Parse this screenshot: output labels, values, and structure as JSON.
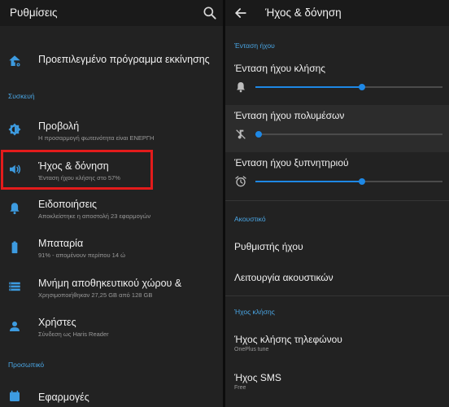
{
  "left": {
    "title": "Ρυθμίσεις",
    "items_top": [
      {
        "title": "Προεπιλεγμένο πρόγραμμα εκκίνησης",
        "icon": "home-gear-icon"
      }
    ],
    "device_header": "Συσκευή",
    "device_items": [
      {
        "title": "Προβολή",
        "subtitle": "Η προσαρμογή φωτεινότητα είναι ΕΝΕΡΓΗ",
        "icon": "brightness-icon"
      },
      {
        "title": "Ήχος & δόνηση",
        "subtitle": "Ένταση ήχου κλήσης στο 57%",
        "icon": "speaker-icon"
      },
      {
        "title": "Ειδοποιήσεις",
        "subtitle": "Αποκλείστηκε η αποστολή 23 εφαρμογών",
        "icon": "bell-icon"
      },
      {
        "title": "Μπαταρία",
        "subtitle": "91% - απομένουν περίπου 14 ώ",
        "icon": "battery-icon"
      },
      {
        "title": "Μνήμη αποθηκευτικού χώρου &",
        "subtitle": "Χρησιμοποιήθηκαν 27,25 GB από 128 GB",
        "icon": "storage-icon"
      },
      {
        "title": "Χρήστες",
        "subtitle": "Σύνδεση ως Haris Reader",
        "icon": "person-icon"
      }
    ],
    "personal_header": "Προσωπικό",
    "personal_items": [
      {
        "title": "Εφαρμογές",
        "icon": "apps-icon"
      }
    ]
  },
  "right": {
    "title": "Ήχος & δόνηση",
    "volume_header": "Ένταση ήχου",
    "volumes": [
      {
        "label": "Ένταση ήχου κλήσης",
        "icon": "bell-icon",
        "level": 0.57
      },
      {
        "label": "Ένταση ήχου πολυμέσων",
        "icon": "music-muted-icon",
        "level": 0.0
      },
      {
        "label": "Ένταση ήχου ξυπνητηριού",
        "icon": "alarm-clock-icon",
        "level": 0.57
      }
    ],
    "audio_header": "Ακουστικό",
    "audio_items": [
      {
        "title": "Ρυθμιστής ήχου"
      },
      {
        "title": "Λειτουργία ακουστικών"
      }
    ],
    "ringtone_header": "Ήχος κλήσης",
    "ringtone_items": [
      {
        "title": "Ήχος κλήσης τηλεφώνου",
        "subtitle": "OnePlus tune"
      },
      {
        "title": "Ήχος SMS",
        "subtitle": "Free"
      }
    ]
  },
  "colors": {
    "background": "#222222",
    "toolbar": "#1a1a1a",
    "accent": "#1e88e5",
    "section_header": "#4aa7e6",
    "highlight_border": "#e31b1b"
  }
}
